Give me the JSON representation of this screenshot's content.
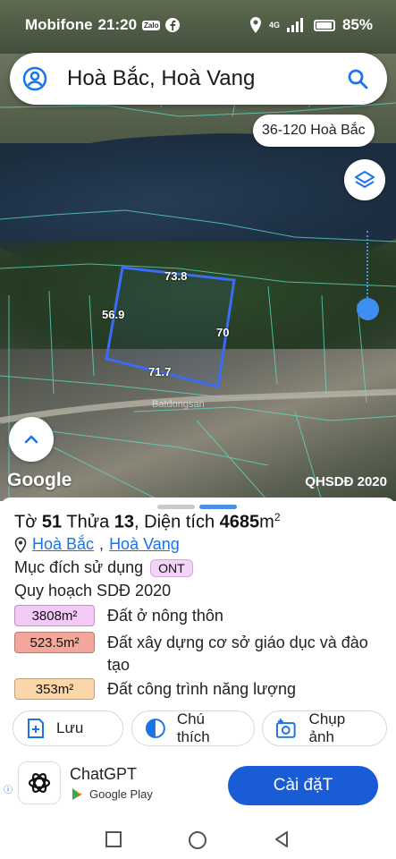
{
  "status_bar": {
    "carrier": "Mobifone",
    "time": "21:20",
    "zalo_badge": "Zalo",
    "signal": "4G",
    "battery": "85%"
  },
  "search": {
    "text": "Hoà Bắc, Hoà Vang"
  },
  "map": {
    "area_chip": "36-120 Hoà Bắc",
    "google_label": "Google",
    "plan_label": "QHSDĐ 2020",
    "watermark": "Batdongsan",
    "dimensions": {
      "top": "73.8",
      "left": "56.9",
      "right": "70",
      "bottom": "71.7"
    }
  },
  "sheet": {
    "title_prefix": "Tờ",
    "sheet_no": "51",
    "parcel_prefix": "Thửa",
    "parcel_no": "13",
    "area_prefix": ", Diện tích",
    "area_value": "4685",
    "area_unit": "m",
    "area_sup": "2",
    "location_commune": "Hoà Bắc",
    "location_district": "Hoà Vang",
    "purpose_label": "Mục đích sử dụng",
    "purpose_code": "ONT",
    "plan_title": "Quy hoạch SDĐ 2020",
    "plan_items": [
      {
        "area": "3808m²",
        "desc": "Đất ở nông thôn",
        "color": "#f3c9f7"
      },
      {
        "area": "523.5m²",
        "desc": "Đất xây dựng cơ sở giáo dục và đào tạo",
        "color": "#f3a79b"
      },
      {
        "area": "353m²",
        "desc": "Đất công trình năng lượng",
        "color": "#fbd6a8"
      }
    ],
    "actions": {
      "save": "Lưu",
      "legend": "Chú thích",
      "photo": "Chụp ảnh"
    }
  },
  "ad": {
    "name": "ChatGPT",
    "store": "Google Play",
    "install": "Cài đặT"
  }
}
